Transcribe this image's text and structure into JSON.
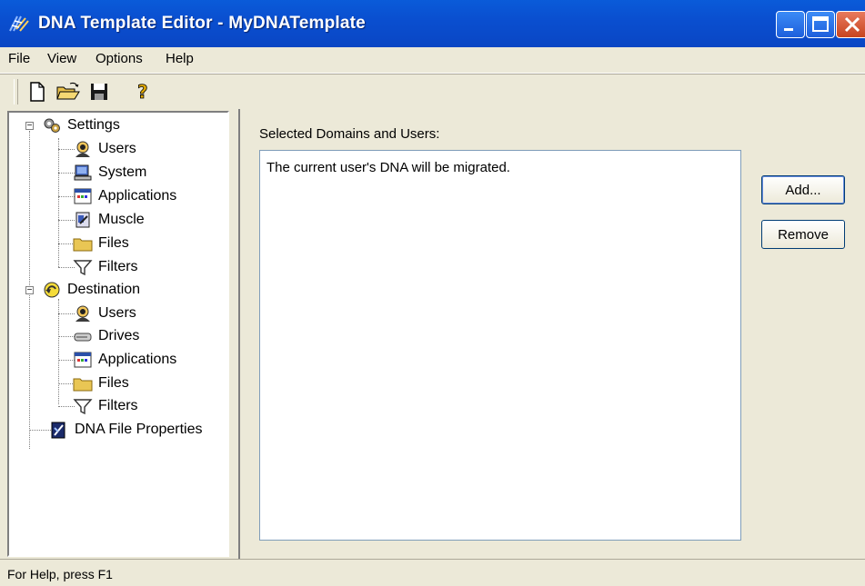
{
  "window": {
    "title": "DNA Template Editor - MyDNATemplate"
  },
  "menu": {
    "items": [
      "File",
      "View",
      "Options",
      "Help"
    ]
  },
  "toolbar": {
    "buttons": [
      "new-document-icon",
      "open-folder-icon",
      "save-icon",
      "help-icon"
    ]
  },
  "tree": {
    "settings": {
      "label": "Settings",
      "children": [
        "Users",
        "System",
        "Applications",
        "Muscle",
        "Files",
        "Filters"
      ]
    },
    "destination": {
      "label": "Destination",
      "children": [
        "Users",
        "Drives",
        "Applications",
        "Files",
        "Filters"
      ]
    },
    "properties": {
      "label": "DNA File Properties"
    }
  },
  "main": {
    "list_label": "Selected Domains and Users:",
    "list_items": [
      "The current user's DNA will be migrated."
    ],
    "add_button": "Add...",
    "remove_button": "Remove"
  },
  "status": {
    "text": "For Help, press F1"
  },
  "colors": {
    "titlebar": "#0a4fd0",
    "chrome": "#ece9d8",
    "close": "#c8441f"
  }
}
